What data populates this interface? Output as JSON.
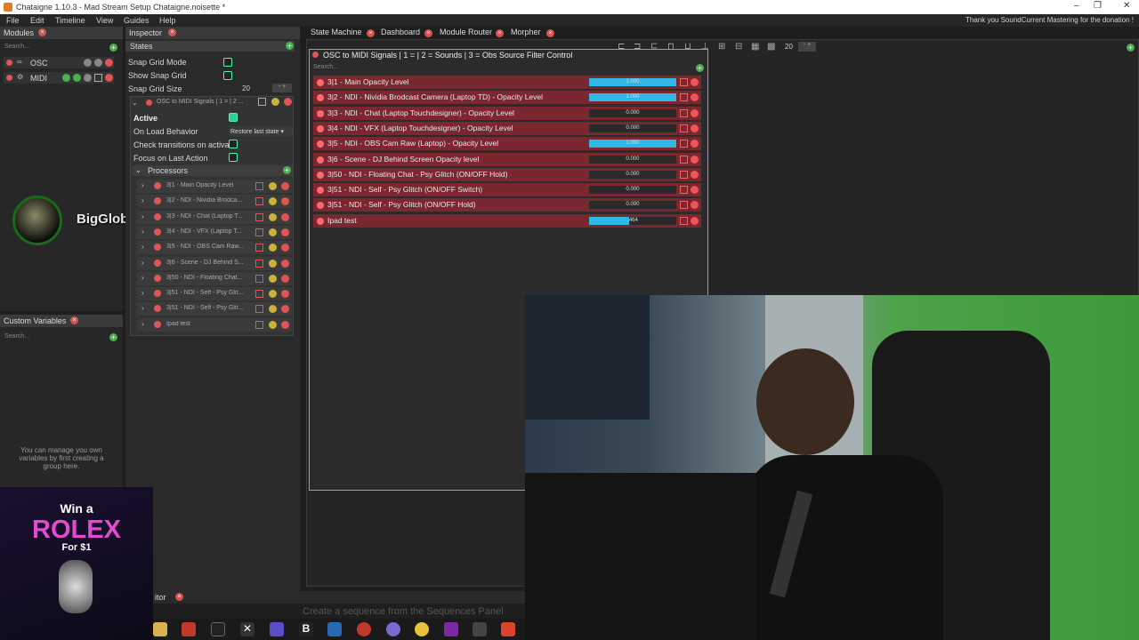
{
  "app": {
    "title": "Chataigne 1.10.3 - Mad Stream Setup Chataigne.noisette *",
    "thanks": "Thank you SoundCurrent Mastering for the donation !"
  },
  "menu": [
    "File",
    "Edit",
    "Timeline",
    "View",
    "Guides",
    "Help"
  ],
  "modules": {
    "title": "Modules",
    "search": "Search...",
    "items": [
      {
        "name": "OSC"
      },
      {
        "name": "MIDI"
      }
    ]
  },
  "custom_vars": {
    "title": "Custom Variables",
    "search": "Search...",
    "hint": "You can manage you own variables by first creating a group here."
  },
  "inspector": {
    "title": "Inspector",
    "states_header": "States",
    "snap_grid_mode": "Snap Grid Mode",
    "show_snap_grid": "Show Snap Grid",
    "snap_grid_size": "Snap Grid Size",
    "snap_grid_size_value": "20",
    "state_name": "OSC to MIDI Signals | 1 =  | 2 ...",
    "active": "Active",
    "on_load": "On Load Behavior",
    "on_load_value": "Restore last state",
    "check_transitions": "Check transitions on activate",
    "focus_last": "Focus on Last Action",
    "processors": "Processors",
    "proc_items": [
      "3|1 - Main Opacity Level",
      "3|2 - NDI - Nividia Brodca...",
      "3|3 - NDI - Chat (Laptop T...",
      "3|4 - NDI - VFX (Laptop T...",
      "3|5 - NDI - OBS Cam Raw...",
      "3|6 - Scene - DJ Behind S...",
      "3|50 - NDI - Floating Chat...",
      "3|51 - NDI - Self - Psy Glit...",
      "3|51 - NDI - Self - Psy Glit...",
      "Ipad test"
    ]
  },
  "tabs": [
    "State Machine",
    "Dashboard",
    "Module Router",
    "Morpher"
  ],
  "toolbar": {
    "grid_value": "20"
  },
  "state": {
    "title": "OSC to MIDI Signals | 1 =  | 2 = Sounds | 3 = Obs Source Filter Control",
    "search": "Search...",
    "signals": [
      {
        "label": "3|1 - Main Opacity Level",
        "value": "1.000",
        "fill": 1.0
      },
      {
        "label": "3|2 - NDI - Nividia Brodcast Camera (Laptop TD) - Opacity Level",
        "value": "1.000",
        "fill": 1.0
      },
      {
        "label": "3|3 - NDI - Chat (Laptop Touchdesigner) - Opacity Level",
        "value": "0.000",
        "fill": 0.0
      },
      {
        "label": "3|4 - NDI - VFX (Laptop Touchdesigner) - Opacity Level",
        "value": "0.000",
        "fill": 0.0
      },
      {
        "label": "3|5 - NDI - OBS Cam Raw (Laptop) - Opacity Level",
        "value": "1.000",
        "fill": 1.0
      },
      {
        "label": "3|6 - Scene - DJ Behind Screen Opacity level",
        "value": "0.000",
        "fill": 0.0
      },
      {
        "label": "3|50 - NDI - Floating Chat - Psy Glitch (ON/OFF Hold)",
        "value": "0.000",
        "fill": 0.0
      },
      {
        "label": "3|51 - NDI - Self - Psy Glitch (ON/OFF Switch)",
        "value": "0.000",
        "fill": 0.0
      },
      {
        "label": "3|51 - NDI - Self - Psy Glitch (ON/OFF Hold)",
        "value": "0.000",
        "fill": 0.0
      },
      {
        "label": "Ipad test",
        "value": ".464",
        "fill": 0.464
      }
    ]
  },
  "overlay": {
    "username": "BigGlobRob",
    "ad_line1": "Win a",
    "ad_brand": "ROLEX",
    "ad_line2": "For $1"
  },
  "bottom": {
    "editor_tab": "itor",
    "hint": "Create a sequence from the Sequences Panel"
  },
  "colors": {
    "accent": "#2fb8e6",
    "state_row": "#7a2730",
    "close": "#d9534f",
    "add": "#4caf50"
  }
}
